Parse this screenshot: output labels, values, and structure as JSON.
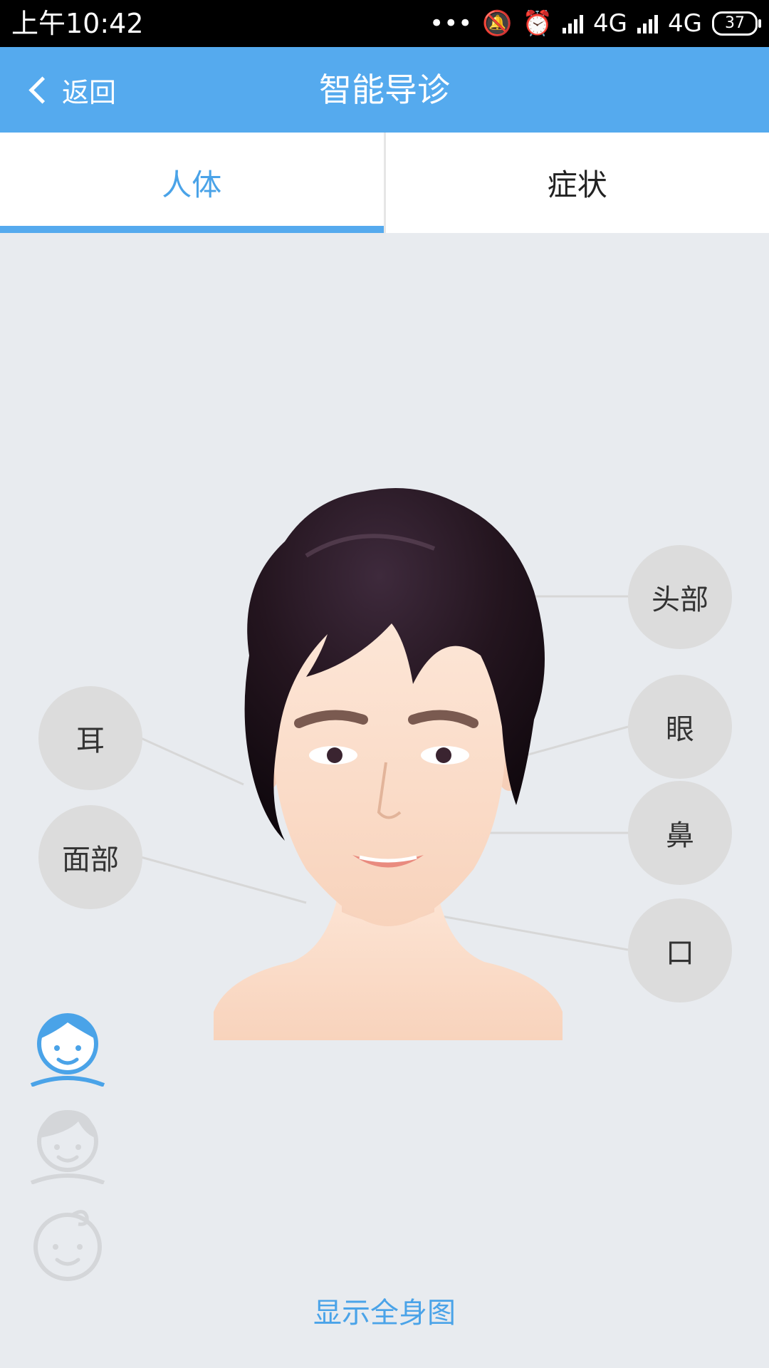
{
  "status_bar": {
    "time": "上午10:42",
    "network_1": "4G",
    "network_2": "4G",
    "battery": "37"
  },
  "header": {
    "back_label": "返回",
    "title": "智能导诊"
  },
  "tabs": [
    {
      "label": "人体",
      "active": true
    },
    {
      "label": "症状",
      "active": false
    }
  ],
  "body_parts": {
    "head": "头部",
    "eye": "眼",
    "nose": "鼻",
    "mouth": "口",
    "ear": "耳",
    "face": "面部"
  },
  "avatars": {
    "male": "male-adult-icon",
    "female": "female-adult-icon",
    "child": "child-icon",
    "selected": "male"
  },
  "footer": {
    "show_full_body": "显示全身图"
  },
  "colors": {
    "accent": "#55aaee",
    "tab_active_text": "#4aa3e8",
    "bubble": "#dcdcdc",
    "background": "#e8ebef"
  }
}
